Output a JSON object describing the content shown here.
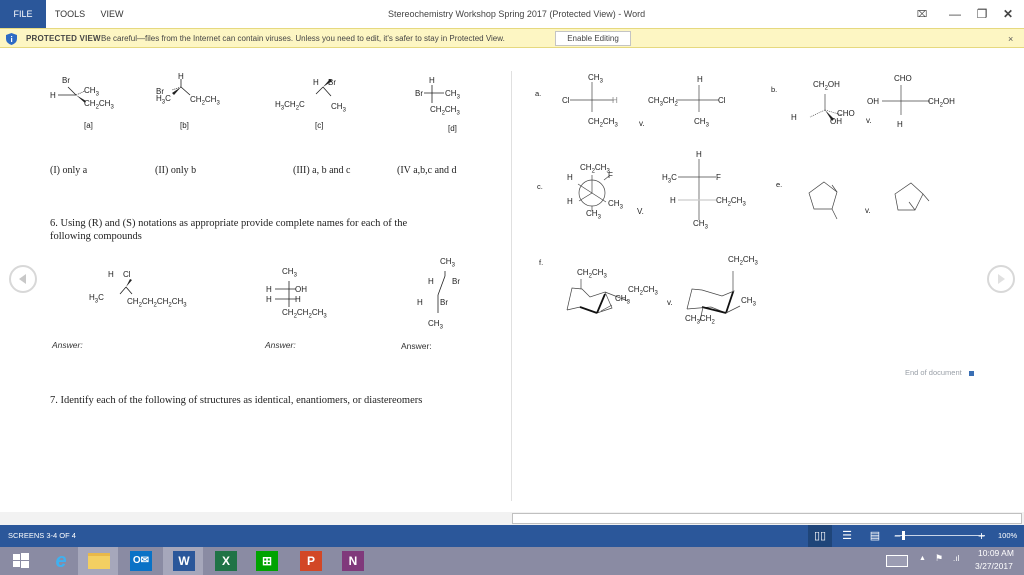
{
  "window": {
    "title": "Stereochemistry Workshop Spring 2017 (Protected View) - Word",
    "menu_tabs": [
      "FILE",
      "TOOLS",
      "VIEW"
    ],
    "controls": {
      "fullscreen": "⌧",
      "minimize": "—",
      "restore": "❐",
      "close": "✕"
    }
  },
  "protected_view": {
    "title": "PROTECTED VIEW",
    "message": "Be careful—files from the Internet can contain viruses. Unless you need to edit, it's safer to stay in Protected View.",
    "enable_button": "Enable Editing",
    "close": "×"
  },
  "left_page": {
    "q5_structures": [
      {
        "label": "[a]",
        "atoms": [
          "Br",
          "H",
          "CH3",
          "CH2CH3"
        ]
      },
      {
        "label": "[b]",
        "atoms": [
          "H",
          "Br",
          "H3C",
          "CH2CH3"
        ]
      },
      {
        "label": "[c]",
        "atoms": [
          "H",
          "Br",
          "H3CH2C",
          "CH3"
        ]
      },
      {
        "label": "[d]",
        "atoms": [
          "H",
          "Br",
          "CH3",
          "CH2CH3"
        ]
      }
    ],
    "q5_options": [
      "(I) only a",
      "(II) only b",
      "(III) a, b and  c",
      "(IV a,b,c and d"
    ],
    "q6_text_line1": "6. Using (R) and (S) notations as appropriate provide complete names for each of the",
    "q6_text_line2": "following compounds",
    "q6_structures": [
      {
        "atoms": [
          "H",
          "Cl",
          "H3C",
          "CH2CH2CH2CH3"
        ]
      },
      {
        "atoms": [
          "CH3",
          "H",
          "OH",
          "H",
          "H",
          "CH2CH2CH3"
        ]
      },
      {
        "atoms": [
          "CH3",
          "H",
          "Br",
          "H",
          "Br",
          "CH3"
        ]
      }
    ],
    "answer_labels": [
      "Answer:",
      "Answer:",
      "Answer:"
    ],
    "q7_text": "7. Identify each of the following of structures as identical, enantiomers, or diastereomers"
  },
  "right_page": {
    "pairs": [
      {
        "letter": "a.",
        "left_atoms": [
          "CH3",
          "Cl",
          "H",
          "CH2CH3"
        ],
        "vs": "v.",
        "right_atoms": [
          "H",
          "CH3CH2",
          "Cl",
          "CH3"
        ]
      },
      {
        "letter": "b.",
        "left_atoms": [
          "CH2OH",
          "H",
          "CHO",
          "OH"
        ],
        "vs": "v.",
        "right_atoms": [
          "CHO",
          "OH",
          "CH2OH",
          "H"
        ]
      },
      {
        "letter": "c.",
        "left_atoms": [
          "CH2CH3",
          "H",
          "F",
          "H",
          "CH3",
          "CH3"
        ],
        "vs": "V.",
        "right_atoms": [
          "H",
          "H3C",
          "F",
          "H",
          "CH2CH3",
          "CH3"
        ]
      },
      {
        "letter": "e.",
        "vs": "v."
      },
      {
        "letter": "f.",
        "left_atoms": [
          "CH2CH3",
          "CH2CH3",
          "CH3"
        ],
        "vs": "v.",
        "right_atoms": [
          "CH2CH3",
          "CH3",
          "CH3CH2"
        ]
      }
    ],
    "end_of_document": "End of document"
  },
  "status_bar": {
    "screens": "SCREENS 3-4 OF 4",
    "zoom_minus": "−",
    "zoom_plus": "+",
    "zoom": "100%",
    "zoom_fraction": 0.1
  },
  "taskbar": {
    "apps": [
      {
        "name": "start",
        "glyph": "⊞"
      },
      {
        "name": "internet-explorer",
        "glyph": "e"
      },
      {
        "name": "file-explorer",
        "glyph": ""
      },
      {
        "name": "outlook",
        "glyph": "O✉"
      },
      {
        "name": "word",
        "glyph": "W"
      },
      {
        "name": "excel",
        "glyph": "X"
      },
      {
        "name": "store",
        "glyph": "⊞"
      },
      {
        "name": "powerpoint",
        "glyph": "P"
      },
      {
        "name": "onenote",
        "glyph": "N"
      }
    ],
    "time": "10:09 AM",
    "date": "3/27/2017"
  },
  "colors": {
    "word_blue": "#2b579a",
    "protected_bar": "#fdf6c3",
    "taskbar": "#8a8ba3"
  }
}
